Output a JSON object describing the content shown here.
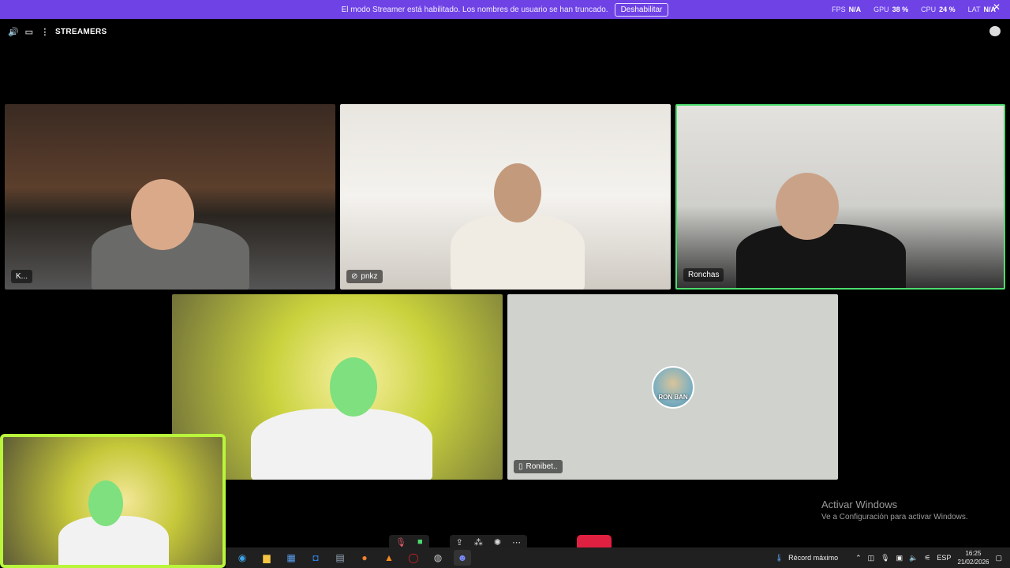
{
  "banner": {
    "message": "El modo Streamer está habilitado. Los nombres de usuario se han truncado.",
    "button_label": "Deshabilitar",
    "color": "#6f42e6"
  },
  "stats": {
    "fps_label": "FPS",
    "fps_value": "N/A",
    "gpu_label": "GPU",
    "gpu_value": "38 %",
    "cpu_label": "CPU",
    "cpu_value": "24 %",
    "lat_label": "LAT",
    "lat_value": "N/A"
  },
  "topbar": {
    "channel_name": "STREAMERS"
  },
  "participants": [
    {
      "name": "K..."
    },
    {
      "name": "pnkz",
      "muted": true
    },
    {
      "name": "Ronchas",
      "speaking": true
    },
    {
      "name": ""
    },
    {
      "name": "Ronibet..",
      "device": "mobile",
      "avatar_text": "RON BAN"
    }
  ],
  "watermark": {
    "line1": "Activar Windows",
    "line2": "Ve a Configuración para activar Windows."
  },
  "taskbar": {
    "weather_text": "Récord máximo",
    "language": "ESP",
    "time": "16:25",
    "date": "21/02/2026",
    "apps": [
      "edge-icon",
      "file-explorer-icon",
      "store-icon",
      "outlook-icon",
      "photos-icon",
      "firefox-icon",
      "vlc-icon",
      "opera-icon",
      "steam-icon",
      "discord-icon"
    ]
  },
  "colors": {
    "speaking_border": "#4cdc6e",
    "self_border": "#b8f53b",
    "hangup": "#e02040"
  }
}
